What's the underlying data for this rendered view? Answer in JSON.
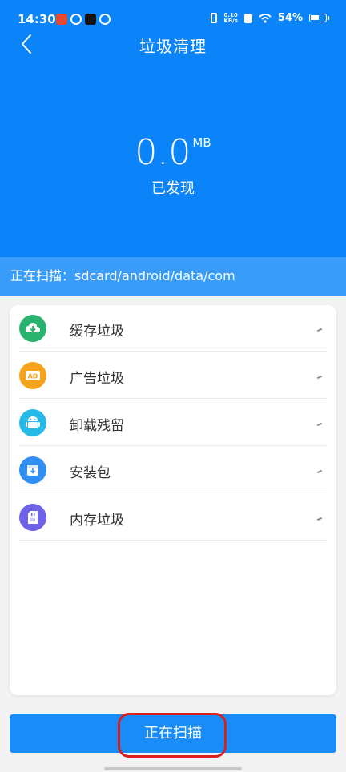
{
  "status_bar": {
    "time": "14:30",
    "net_speed_top": "0.10",
    "net_speed_unit": "KB/s",
    "battery_percent": "54%"
  },
  "header": {
    "title": "垃圾清理"
  },
  "summary": {
    "size_value": "0.0",
    "size_unit": "MB",
    "found_label": "已发现"
  },
  "scan": {
    "status_text": "正在扫描：sdcard/android/data/com"
  },
  "categories": [
    {
      "label": "缓存垃圾",
      "icon": "cloud-download-icon",
      "color": "#2ab36f"
    },
    {
      "label": "广告垃圾",
      "icon": "ad-icon",
      "color": "#f5a31a"
    },
    {
      "label": "卸载残留",
      "icon": "android-icon",
      "color": "#26b9e8"
    },
    {
      "label": "安装包",
      "icon": "package-icon",
      "color": "#2f8ff2"
    },
    {
      "label": "内存垃圾",
      "icon": "sd-card-icon",
      "color": "#6e62e8"
    }
  ],
  "action_button": {
    "label": "正在扫描"
  },
  "colors": {
    "primary": "#0b84f9",
    "strip": "#3a9cf9",
    "highlight": "#d8211d"
  }
}
